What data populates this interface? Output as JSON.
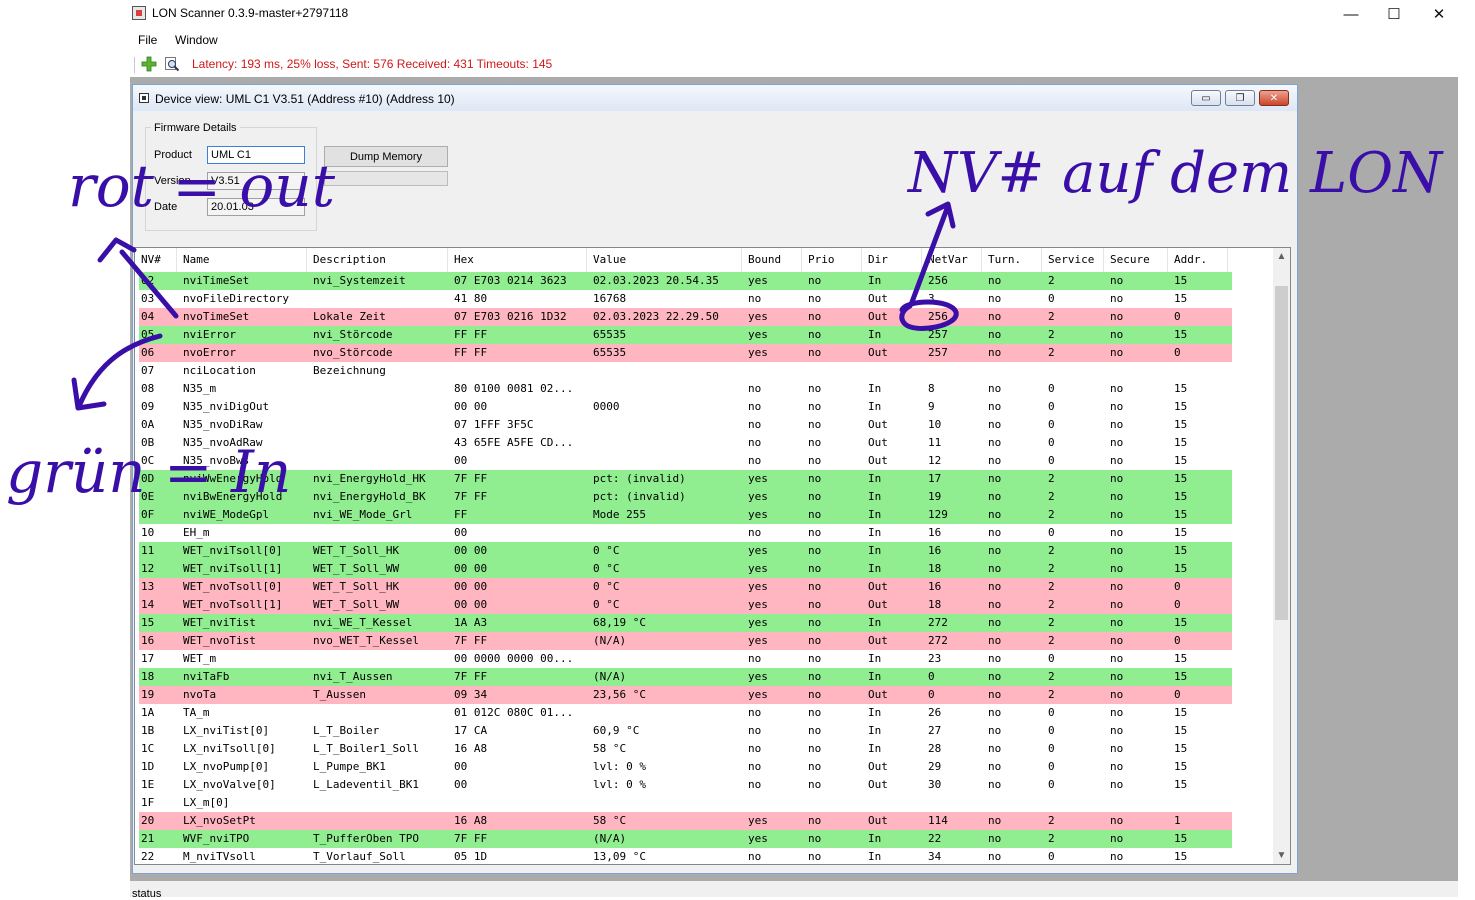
{
  "window": {
    "title": "LON Scanner  0.3.9-master+2797118",
    "minimize": "—",
    "maximize": "☐",
    "close": "✕"
  },
  "menu": {
    "file": "File",
    "window": "Window"
  },
  "toolbar": {
    "add_icon": "plus-icon",
    "find_icon": "magnifier-icon",
    "latency": "Latency: 193 ms, 25% loss, Sent: 576 Received: 431 Timeouts: 145"
  },
  "device_window": {
    "title": "Device view: UML C1 V3.51 (Address #10) (Address 10)",
    "min": "▭",
    "restore": "❐",
    "close": "✕"
  },
  "firmware": {
    "legend": "Firmware Details",
    "product_label": "Product",
    "product_value": "UML C1",
    "version_label": "Version",
    "version_value": "V3.51",
    "date_label": "Date",
    "date_value": "20.01.03",
    "dump_button": "Dump Memory"
  },
  "table": {
    "columns": [
      "NV#",
      "Name",
      "Description",
      "Hex",
      "Value",
      "Bound",
      "Prio",
      "Dir",
      "NetVar",
      "Turn.",
      "Service",
      "Secure",
      "Addr."
    ],
    "rows": [
      {
        "c": "g",
        "v": [
          "02",
          "nviTimeSet",
          "nvi_Systemzeit",
          "07 E703 0214 3623",
          "02.03.2023 20.54.35",
          "yes",
          "no",
          "In",
          "256",
          "no",
          "2",
          "no",
          "15"
        ]
      },
      {
        "c": "w",
        "v": [
          "03",
          "nvoFileDirectory",
          "",
          "41 80",
          "16768",
          "no",
          "no",
          "Out",
          "3",
          "no",
          "0",
          "no",
          "15"
        ]
      },
      {
        "c": "r",
        "v": [
          "04",
          "nvoTimeSet",
          "Lokale Zeit",
          "07 E703 0216 1D32",
          "02.03.2023 22.29.50",
          "yes",
          "no",
          "Out",
          "256",
          "no",
          "2",
          "no",
          "0"
        ]
      },
      {
        "c": "g",
        "v": [
          "05",
          "nviError",
          "nvi_Störcode",
          "FF FF",
          "65535",
          "yes",
          "no",
          "In",
          "257",
          "no",
          "2",
          "no",
          "15"
        ]
      },
      {
        "c": "r",
        "v": [
          "06",
          "nvoError",
          "nvo_Störcode",
          "FF FF",
          "65535",
          "yes",
          "no",
          "Out",
          "257",
          "no",
          "2",
          "no",
          "0"
        ]
      },
      {
        "c": "w",
        "v": [
          "07",
          "nciLocation",
          "Bezeichnung",
          "",
          "",
          "",
          "",
          "",
          "",
          "",
          "",
          "",
          ""
        ]
      },
      {
        "c": "w",
        "v": [
          "08",
          "N35_m",
          "",
          "80 0100 0081 02...",
          "",
          "no",
          "no",
          "In",
          "8",
          "no",
          "0",
          "no",
          "15"
        ]
      },
      {
        "c": "w",
        "v": [
          "09",
          "N35_nviDigOut",
          "",
          "00 00",
          "0000",
          "no",
          "no",
          "In",
          "9",
          "no",
          "0",
          "no",
          "15"
        ]
      },
      {
        "c": "w",
        "v": [
          "0A",
          "N35_nvoDiRaw",
          "",
          "07 1FFF 3F5C",
          "",
          "no",
          "no",
          "Out",
          "10",
          "no",
          "0",
          "no",
          "15"
        ]
      },
      {
        "c": "w",
        "v": [
          "0B",
          "N35_nvoAdRaw",
          "",
          "43 65FE A5FE CD...",
          "",
          "no",
          "no",
          "Out",
          "11",
          "no",
          "0",
          "no",
          "15"
        ]
      },
      {
        "c": "w",
        "v": [
          "0C",
          "N35_nvoBws",
          "",
          "00",
          "",
          "no",
          "no",
          "Out",
          "12",
          "no",
          "0",
          "no",
          "15"
        ]
      },
      {
        "c": "g",
        "v": [
          "0D",
          "nviWwEnergyHold",
          "nvi_EnergyHold_HK",
          "7F FF",
          "pct: (invalid)",
          "yes",
          "no",
          "In",
          "17",
          "no",
          "2",
          "no",
          "15"
        ]
      },
      {
        "c": "g",
        "v": [
          "0E",
          "nviBwEnergyHold",
          "nvi_EnergyHold_BK",
          "7F FF",
          "pct: (invalid)",
          "yes",
          "no",
          "In",
          "19",
          "no",
          "2",
          "no",
          "15"
        ]
      },
      {
        "c": "g",
        "v": [
          "0F",
          "nviWE_ModeGpl",
          "nvi_WE_Mode_Grl",
          "FF",
          "Mode 255",
          "yes",
          "no",
          "In",
          "129",
          "no",
          "2",
          "no",
          "15"
        ]
      },
      {
        "c": "w",
        "v": [
          "10",
          "EH_m",
          "",
          "00",
          "",
          "no",
          "no",
          "In",
          "16",
          "no",
          "0",
          "no",
          "15"
        ]
      },
      {
        "c": "g",
        "v": [
          "11",
          "WET_nviTsoll[0]",
          "WET_T_Soll_HK",
          "00 00",
          "0 °C",
          "yes",
          "no",
          "In",
          "16",
          "no",
          "2",
          "no",
          "15"
        ]
      },
      {
        "c": "g",
        "v": [
          "12",
          "WET_nviTsoll[1]",
          "WET_T_Soll_WW",
          "00 00",
          "0 °C",
          "yes",
          "no",
          "In",
          "18",
          "no",
          "2",
          "no",
          "15"
        ]
      },
      {
        "c": "r",
        "v": [
          "13",
          "WET_nvoTsoll[0]",
          "WET_T_Soll_HK",
          "00 00",
          "0 °C",
          "yes",
          "no",
          "Out",
          "16",
          "no",
          "2",
          "no",
          "0"
        ]
      },
      {
        "c": "r",
        "v": [
          "14",
          "WET_nvoTsoll[1]",
          "WET_T_Soll_WW",
          "00 00",
          "0 °C",
          "yes",
          "no",
          "Out",
          "18",
          "no",
          "2",
          "no",
          "0"
        ]
      },
      {
        "c": "g",
        "v": [
          "15",
          "WET_nviTist",
          "nvi_WE_T_Kessel",
          "1A A3",
          "68,19 °C",
          "yes",
          "no",
          "In",
          "272",
          "no",
          "2",
          "no",
          "15"
        ]
      },
      {
        "c": "r",
        "v": [
          "16",
          "WET_nvoTist",
          "nvo_WET_T_Kessel",
          "7F FF",
          "(N/A)",
          "yes",
          "no",
          "Out",
          "272",
          "no",
          "2",
          "no",
          "0"
        ]
      },
      {
        "c": "w",
        "v": [
          "17",
          "WET_m",
          "",
          "00 0000 0000 00...",
          "",
          "no",
          "no",
          "In",
          "23",
          "no",
          "0",
          "no",
          "15"
        ]
      },
      {
        "c": "g",
        "v": [
          "18",
          "nviTaFb",
          "nvi_T_Aussen",
          "7F FF",
          "(N/A)",
          "yes",
          "no",
          "In",
          "0",
          "no",
          "2",
          "no",
          "15"
        ]
      },
      {
        "c": "r",
        "v": [
          "19",
          "nvoTa",
          "T_Aussen",
          "09 34",
          "23,56 °C",
          "yes",
          "no",
          "Out",
          "0",
          "no",
          "2",
          "no",
          "0"
        ]
      },
      {
        "c": "w",
        "v": [
          "1A",
          "TA_m",
          "",
          "01 012C 080C 01...",
          "",
          "no",
          "no",
          "In",
          "26",
          "no",
          "0",
          "no",
          "15"
        ]
      },
      {
        "c": "w",
        "v": [
          "1B",
          "LX_nviTist[0]",
          "L_T_Boiler",
          "17 CA",
          "60,9 °C",
          "no",
          "no",
          "In",
          "27",
          "no",
          "0",
          "no",
          "15"
        ]
      },
      {
        "c": "w",
        "v": [
          "1C",
          "LX_nviTsoll[0]",
          "L_T_Boiler1_Soll",
          "16 A8",
          "58 °C",
          "no",
          "no",
          "In",
          "28",
          "no",
          "0",
          "no",
          "15"
        ]
      },
      {
        "c": "w",
        "v": [
          "1D",
          "LX_nvoPump[0]",
          "L_Pumpe_BK1",
          "00",
          "lvl: 0 %",
          "no",
          "no",
          "Out",
          "29",
          "no",
          "0",
          "no",
          "15"
        ]
      },
      {
        "c": "w",
        "v": [
          "1E",
          "LX_nvoValve[0]",
          "L_Ladeventil_BK1",
          "00",
          "lvl: 0 %",
          "no",
          "no",
          "Out",
          "30",
          "no",
          "0",
          "no",
          "15"
        ]
      },
      {
        "c": "w",
        "v": [
          "1F",
          "LX_m[0]",
          "",
          "",
          "",
          "",
          "",
          "",
          "",
          "",
          "",
          "",
          ""
        ]
      },
      {
        "c": "r",
        "v": [
          "20",
          "LX_nvoSetPt",
          "",
          "16 A8",
          "58 °C",
          "yes",
          "no",
          "Out",
          "114",
          "no",
          "2",
          "no",
          "1"
        ]
      },
      {
        "c": "g",
        "v": [
          "21",
          "WVF_nviTPO",
          "T_PufferOben TPO",
          "7F FF",
          "(N/A)",
          "yes",
          "no",
          "In",
          "22",
          "no",
          "2",
          "no",
          "15"
        ]
      },
      {
        "c": "w",
        "v": [
          "22",
          "M_nviTVsoll",
          "T_Vorlauf_Soll",
          "05 1D",
          "13,09 °C",
          "no",
          "no",
          "In",
          "34",
          "no",
          "0",
          "no",
          "15"
        ]
      }
    ]
  },
  "status": {
    "text": "status"
  },
  "annotations": {
    "rot": "rot = out",
    "gruen": "grün = In",
    "nv": "NV# auf dem LON",
    "ink_color": "#3a0fa8"
  }
}
